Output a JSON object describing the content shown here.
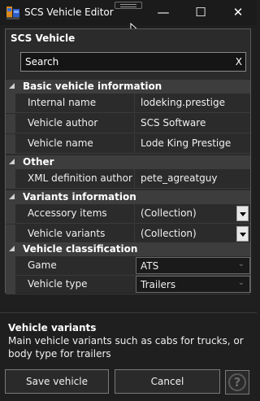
{
  "window": {
    "title": "SCS Vehicle Editor",
    "minimize_glyph": "—",
    "maximize_glyph": "☐",
    "close_glyph": "✕"
  },
  "panel": {
    "title": "SCS Vehicle",
    "search": {
      "value": "Search",
      "clear": "X"
    }
  },
  "grid": {
    "categories": [
      {
        "label": "Basic vehicle information",
        "rows": [
          {
            "name": "Internal name",
            "value": "lodeking.prestige"
          },
          {
            "name": "Vehicle author",
            "value": "SCS Software"
          },
          {
            "name": "Vehicle name",
            "value": "Lode King Prestige"
          }
        ]
      },
      {
        "label": "Other",
        "rows": [
          {
            "name": "XML definition author",
            "value": "pete_agreatguy"
          }
        ]
      },
      {
        "label": "Variants information",
        "rows": [
          {
            "name": "Accessory items",
            "value": "(Collection)"
          },
          {
            "name": "Vehicle variants",
            "value": "(Collection)"
          }
        ]
      },
      {
        "label": "Vehicle classification",
        "rows": [
          {
            "name": "Game",
            "value": "ATS"
          },
          {
            "name": "Vehicle type",
            "value": "Trailers"
          }
        ]
      }
    ],
    "chevron": "⌄"
  },
  "help": {
    "title": "Vehicle variants",
    "text": "Main vehicle variants such as cabs for trucks, or body type for trailers"
  },
  "buttons": {
    "save": "Save vehicle",
    "cancel": "Cancel",
    "help": "?"
  },
  "colors": {
    "background": "#1f1f1f",
    "panel": "#2b2b2b",
    "category_band": "#3d3d3d"
  }
}
